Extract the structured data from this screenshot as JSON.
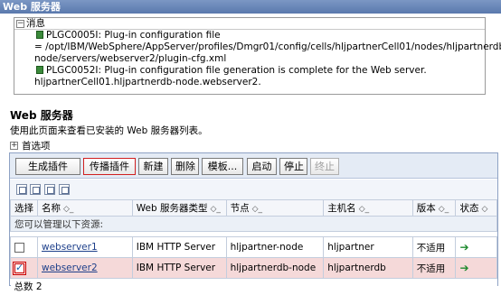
{
  "window": {
    "title": "Web 服务器"
  },
  "messages": {
    "heading": "消息",
    "lines": [
      "PLGC0005I: Plug-in configuration file",
      "= /opt/IBM/WebSphere/AppServer/profiles/Dmgr01/config/cells/hljpartnerCell01/nodes/hljpartnerdb-",
      "node/servers/webserver2/plugin-cfg.xml",
      "PLGC0052I: Plug-in configuration file generation is complete for the Web server.",
      "hljpartnerCell01.hljpartnerdb-node.webserver2."
    ]
  },
  "section": {
    "title": "Web 服务器",
    "description": "使用此页面来查看已安装的 Web 服务器列表。",
    "preferences": "首选项"
  },
  "toolbar": {
    "buttons": [
      "生成插件",
      "传播插件",
      "新建",
      "删除",
      "模板...",
      "启动",
      "停止",
      "终止"
    ]
  },
  "table": {
    "headers": [
      "选择",
      "名称",
      "Web 服务器类型",
      "节点",
      "主机名",
      "版本",
      "状态"
    ],
    "manage_text": "您可以管理以下资源:",
    "rows": [
      {
        "name": "webserver1",
        "type": "IBM HTTP Server",
        "node": "hljpartner-node",
        "host": "hljpartner",
        "version": "不适用",
        "status": "➔",
        "selected": false
      },
      {
        "name": "webserver2",
        "type": "IBM HTTP Server",
        "node": "hljpartnerdb-node",
        "host": "hljpartnerdb",
        "version": "不适用",
        "status": "➔",
        "selected": true
      }
    ],
    "total": "总数 2"
  },
  "icons": {
    "sort": "sort-arrows-icon",
    "status": "green-arrow-icon",
    "message": "message-icon"
  },
  "colors": {
    "title_bar": "#5a79ad",
    "selected_row": "#f5d9d9",
    "link": "#1d3f8a",
    "status_green": "#1e8a2e"
  }
}
